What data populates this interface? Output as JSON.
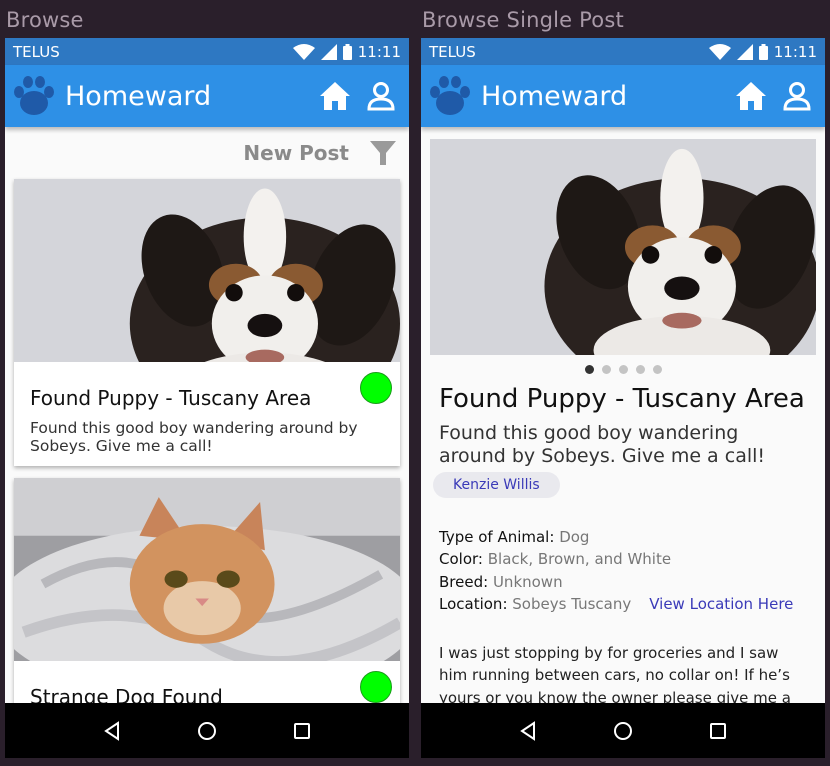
{
  "labels": {
    "left": "Browse",
    "right": "Browse Single Post"
  },
  "statusbar": {
    "carrier": "TELUS",
    "time": "11:11"
  },
  "appbar": {
    "title": "Homeward",
    "home_icon": "home-icon",
    "account_icon": "account-icon",
    "logo_icon": "paw-icon"
  },
  "colors": {
    "appbar": "#2e90e6",
    "statusbar": "#2e78c2",
    "found": "#00ff00",
    "link": "#3a3ab8"
  },
  "browse": {
    "new_post": "New Post",
    "filter_icon": "filter-icon",
    "posts": [
      {
        "title": "Found Puppy - Tuscany Area",
        "desc": "Found this good boy wandering around by Sobeys. Give me a call!",
        "photo": "puppy"
      },
      {
        "title": "Strange Dog Found",
        "desc": "",
        "photo": "cat"
      }
    ]
  },
  "single": {
    "title": "Found Puppy - Tuscany Area",
    "desc": "Found this good boy wandering around by Sobeys. Give me a call!",
    "author": "Kenzie Willis",
    "carousel": {
      "count": 5,
      "active": 1
    },
    "details": {
      "animal_label": "Type of Animal:",
      "animal": "Dog",
      "color_label": "Color:",
      "color": "Black, Brown, and White",
      "breed_label": "Breed:",
      "breed": "Unknown",
      "location_label": "Location:",
      "location": "Sobeys Tuscany",
      "location_link": "View Location Here"
    },
    "story": "I was just stopping by for groceries and I saw him running between cars, no collar on! If he’s yours or you know the owner please give me a"
  },
  "navbar": {
    "back": "back-icon",
    "home": "home-circle-icon",
    "recents": "recents-icon"
  }
}
